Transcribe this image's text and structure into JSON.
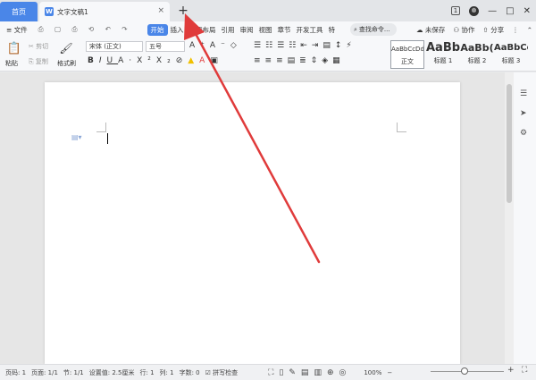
{
  "title_bar": {
    "home_tab": "首页",
    "doc_tab": "文字文稿1",
    "doc_icon": "W",
    "close_glyph": "×",
    "new_tab_glyph": "+",
    "badge": "1",
    "minimize": "—",
    "maximize": "□",
    "close": "✕"
  },
  "menu": {
    "file": "≡ 文件",
    "tabs": [
      "开始",
      "插入",
      "页面布局",
      "引用",
      "审阅",
      "视图",
      "章节",
      "开发工具",
      "特"
    ],
    "search": "查找命令...",
    "unsaved": "未保存",
    "collab": "协作",
    "share": "分享"
  },
  "ribbon": {
    "paste": "粘贴",
    "cut": "剪切",
    "copy": "复制",
    "format_painter": "格式刷",
    "font_name": "宋体 (正文)",
    "font_size": "五号",
    "styles": [
      {
        "sample": "AaBbCcDd",
        "label": "正文"
      },
      {
        "sample": "AaBb",
        "label": "标题 1"
      },
      {
        "sample": "AaBb(",
        "label": "标题 2"
      },
      {
        "sample": "AaBbCc",
        "label": "标题 3"
      }
    ]
  },
  "status": {
    "page": "页码: 1",
    "pages": "页面: 1/1",
    "section": "节: 1/1",
    "setting": "设置值: 2.5厘米",
    "row": "行: 1",
    "col": "列: 1",
    "words": "字数: 0",
    "spellcheck": "拼写检查",
    "zoom": "100%",
    "zoom_minus": "−",
    "zoom_plus": "+"
  },
  "colors": {
    "accent": "#4a86e8",
    "arrow": "#e03b3b"
  }
}
